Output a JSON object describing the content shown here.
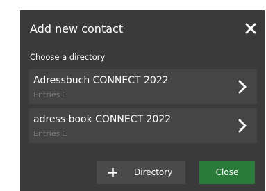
{
  "dialog": {
    "title": "Add new contact",
    "close_icon": "close-icon",
    "subtitle": "Choose a directory"
  },
  "directories": [
    {
      "name": "Adressbuch CONNECT 2022",
      "entries": "Entries 1",
      "icon": "chevron-right-icon"
    },
    {
      "name": "adress book CONNECT 2022",
      "entries": "Entries 1",
      "icon": "chevron-right-icon"
    }
  ],
  "buttons": {
    "directory_label": "Directory",
    "directory_icon": "plus-icon",
    "close_label": "Close"
  },
  "colors": {
    "dialog_bg": "#3a3a3a",
    "item_bg": "#454545",
    "close_button_bg": "#2a7a3a",
    "secondary_button_bg": "#4a4a4a",
    "text": "#ffffff",
    "muted_text": "#7a7a7a"
  }
}
